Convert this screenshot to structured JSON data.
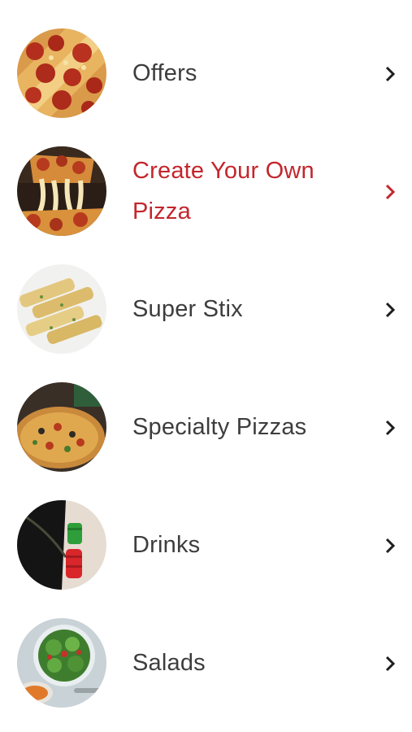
{
  "menu": {
    "items": [
      {
        "label": "Offers",
        "image_icon": "pepperoni-pizza-image",
        "chevron_icon": "chevron-right-icon",
        "active": false
      },
      {
        "label": "Create Your Own Pizza",
        "image_icon": "cheese-pull-pizza-image",
        "chevron_icon": "chevron-right-icon",
        "active": true
      },
      {
        "label": "Super Stix",
        "image_icon": "breadsticks-image",
        "chevron_icon": "chevron-right-icon",
        "active": false
      },
      {
        "label": "Specialty Pizzas",
        "image_icon": "specialty-pizza-image",
        "chevron_icon": "chevron-right-icon",
        "active": false
      },
      {
        "label": "Drinks",
        "image_icon": "soda-bottles-image",
        "chevron_icon": "chevron-right-icon",
        "active": false
      },
      {
        "label": "Salads",
        "image_icon": "salad-bowl-image",
        "chevron_icon": "chevron-right-icon",
        "active": false
      }
    ]
  },
  "colors": {
    "text": "#3d3d3d",
    "active": "#c3262c",
    "chevron": "#1e1e1e",
    "background": "#ffffff"
  }
}
